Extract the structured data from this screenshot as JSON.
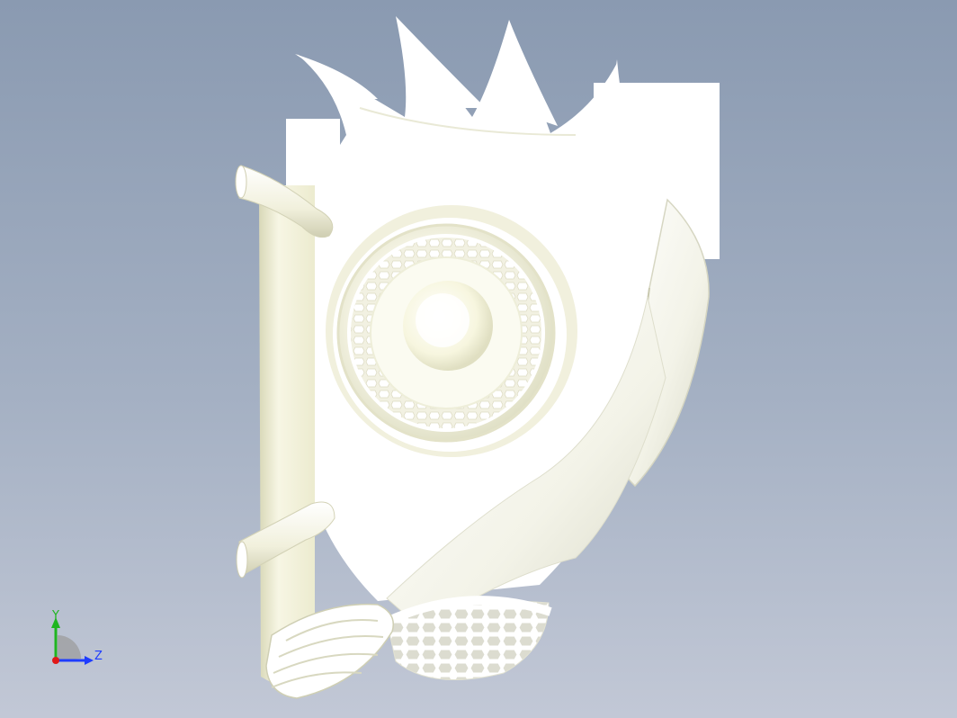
{
  "axes": {
    "y_label": "Y",
    "z_label": "Z",
    "colors": {
      "y": "#1fb51f",
      "z": "#1e3cff",
      "x": "#e01818"
    }
  },
  "model": {
    "body_color": "#ffffff",
    "shadow_color": "#e9e9d2",
    "cylinder_color": "#f4f2da"
  }
}
